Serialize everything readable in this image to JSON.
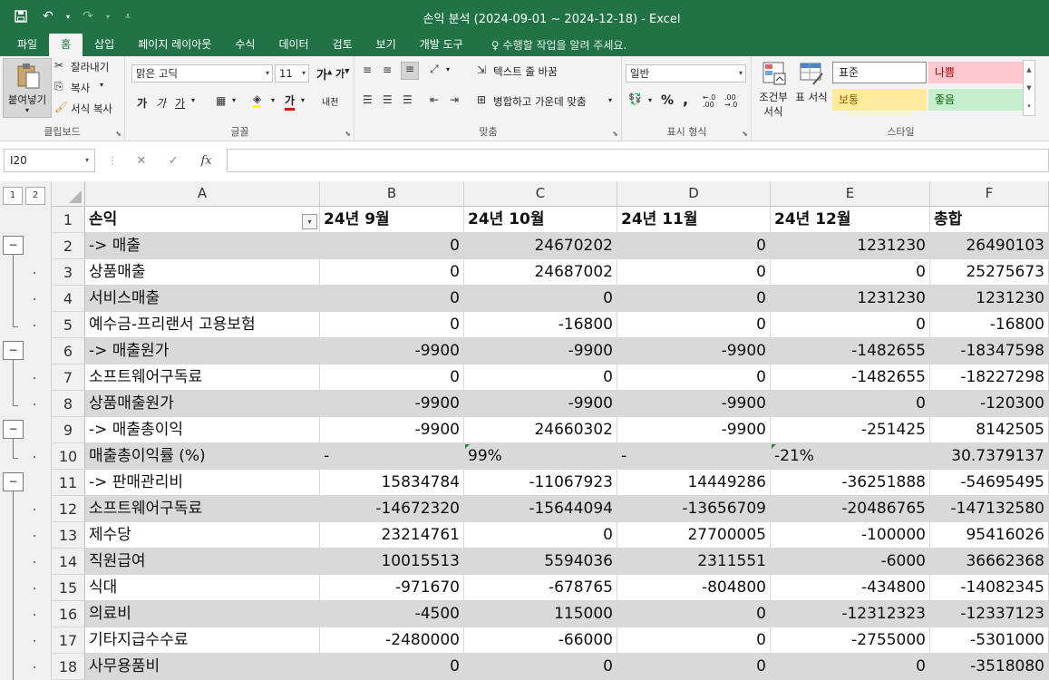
{
  "window": {
    "title": "손익 분석 (2024-09-01 ~ 2024-12-18)  -  Excel"
  },
  "tabs": [
    "파일",
    "홈",
    "삽입",
    "페이지 레이아웃",
    "수식",
    "데이터",
    "검토",
    "보기",
    "개발 도구"
  ],
  "active_tab": "홈",
  "tell_me": "수행할 작업을 알려 주세요.",
  "ribbon": {
    "clipboard": {
      "paste": "붙여넣기",
      "cut": "잘라내기",
      "copy": "복사",
      "format_painter": "서식 복사",
      "label": "클립보드"
    },
    "font": {
      "name": "맑은 고딕",
      "size": "11",
      "bold": "가",
      "italic": "가",
      "underline": "가",
      "label": "글꼴",
      "phonetic": "내천"
    },
    "alignment": {
      "wrap": "텍스트 줄 바꿈",
      "merge": "병합하고 가운데 맞춤",
      "label": "맞춤"
    },
    "number": {
      "format": "일반",
      "label": "표시 형식"
    },
    "styles": {
      "conditional": "조건부 서식",
      "table": "표 서식",
      "label": "스타일",
      "cells": [
        {
          "name": "표준",
          "bg": "#ffffff",
          "border": "#888888"
        },
        {
          "name": "나쁨",
          "bg": "#ffc7ce",
          "border": "#ffc7ce"
        },
        {
          "name": "보통",
          "bg": "#ffeb9c",
          "border": "#ffeb9c"
        },
        {
          "name": "좋음",
          "bg": "#c6efce",
          "border": "#c6efce"
        }
      ]
    }
  },
  "formula_bar": {
    "name_box": "I20",
    "content": ""
  },
  "outline_levels": [
    "1",
    "2"
  ],
  "columns": [
    {
      "id": "A",
      "width": 259
    },
    {
      "id": "B",
      "width": 159
    },
    {
      "id": "C",
      "width": 169
    },
    {
      "id": "D",
      "width": 169
    },
    {
      "id": "E",
      "width": 176
    },
    {
      "id": "F",
      "width": 131
    }
  ],
  "rows": [
    {
      "n": "1",
      "cells": [
        "손익",
        "24년 9월",
        "24년 10월",
        "24년 11월",
        "24년 12월",
        "총합"
      ],
      "header": true
    },
    {
      "n": "2",
      "cells": [
        " -> 매출",
        "0",
        "24670202",
        "0",
        "1231230",
        "26490103"
      ]
    },
    {
      "n": "3",
      "cells": [
        "상품매출",
        "0",
        "24687002",
        "0",
        "0",
        "25275673"
      ]
    },
    {
      "n": "4",
      "cells": [
        "서비스매출",
        "0",
        "0",
        "0",
        "1231230",
        "1231230"
      ]
    },
    {
      "n": "5",
      "cells": [
        "예수금-프리랜서 고용보험",
        "0",
        "-16800",
        "0",
        "0",
        "-16800"
      ]
    },
    {
      "n": "6",
      "cells": [
        " -> 매출원가",
        "-9900",
        "-9900",
        "-9900",
        "-1482655",
        "-18347598"
      ]
    },
    {
      "n": "7",
      "cells": [
        "소프트웨어구독료",
        "0",
        "0",
        "0",
        "-1482655",
        "-18227298"
      ]
    },
    {
      "n": "8",
      "cells": [
        "상품매출원가",
        "-9900",
        "-9900",
        "-9900",
        "0",
        "-120300"
      ]
    },
    {
      "n": "9",
      "cells": [
        " -> 매출총이익",
        "-9900",
        "24660302",
        "-9900",
        "-251425",
        "8142505"
      ]
    },
    {
      "n": "10",
      "cells": [
        "매출총이익률 (%)",
        "-",
        "99%",
        "-",
        "-21%",
        "30.7379137"
      ],
      "left_text": true
    },
    {
      "n": "11",
      "cells": [
        " -> 판매관리비",
        "15834784",
        "-11067923",
        "14449286",
        "-36251888",
        "-54695495"
      ]
    },
    {
      "n": "12",
      "cells": [
        "소프트웨어구독료",
        "-14672320",
        "-15644094",
        "-13656709",
        "-20486765",
        "-147132580"
      ]
    },
    {
      "n": "13",
      "cells": [
        "제수당",
        "23214761",
        "0",
        "27700005",
        "-100000",
        "95416026"
      ]
    },
    {
      "n": "14",
      "cells": [
        "직원급여",
        "10015513",
        "5594036",
        "2311551",
        "-6000",
        "36662368"
      ]
    },
    {
      "n": "15",
      "cells": [
        "식대",
        "-971670",
        "-678765",
        "-804800",
        "-434800",
        "-14082345"
      ]
    },
    {
      "n": "16",
      "cells": [
        "의료비",
        "-4500",
        "115000",
        "0",
        "-12312323",
        "-12337123"
      ]
    },
    {
      "n": "17",
      "cells": [
        "기타지급수수료",
        "-2480000",
        "-66000",
        "0",
        "-2755000",
        "-5301000"
      ]
    },
    {
      "n": "18",
      "cells": [
        "사무용품비",
        "0",
        "0",
        "0",
        "0",
        "-3518080"
      ]
    }
  ],
  "colors": {
    "excel_green": "#217346",
    "band": "#d9d9d9"
  }
}
